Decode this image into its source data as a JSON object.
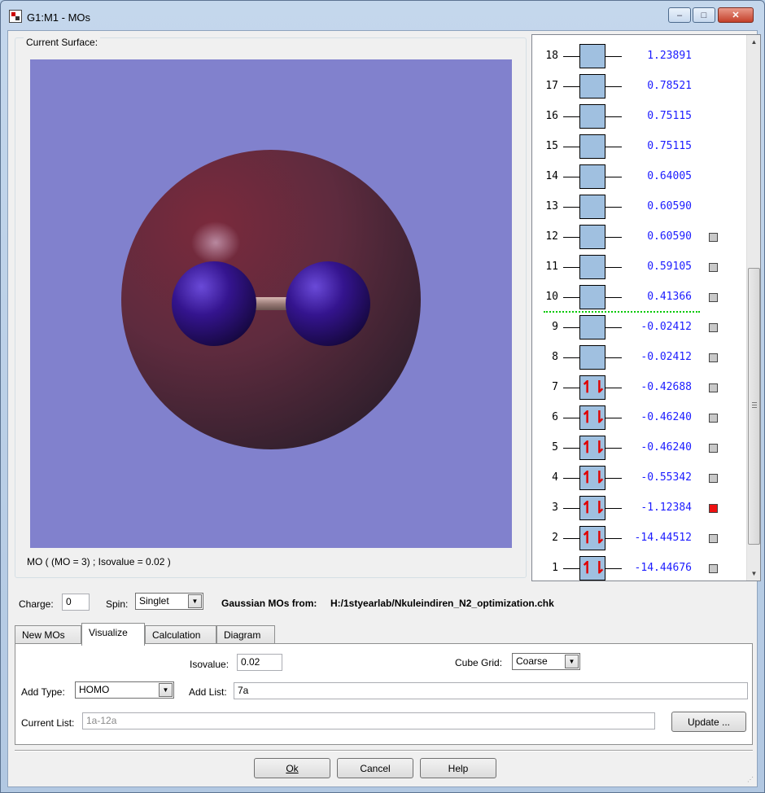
{
  "window": {
    "title": "G1:M1 - MOs",
    "minimize_glyph": "‒",
    "maximize_glyph": "□",
    "close_glyph": "✕"
  },
  "surface": {
    "legend": "Current Surface:",
    "caption": "MO ( (MO = 3) ; Isovalue = 0.02 )",
    "background_color": "#8181cd"
  },
  "mo_list": {
    "orbitals": [
      {
        "num": "18",
        "energy": "1.23891",
        "occupied": false,
        "checkbox": false
      },
      {
        "num": "17",
        "energy": "0.78521",
        "occupied": false,
        "checkbox": false
      },
      {
        "num": "16",
        "energy": "0.75115",
        "occupied": false,
        "checkbox": false
      },
      {
        "num": "15",
        "energy": "0.75115",
        "occupied": false,
        "checkbox": false
      },
      {
        "num": "14",
        "energy": "0.64005",
        "occupied": false,
        "checkbox": false
      },
      {
        "num": "13",
        "energy": "0.60590",
        "occupied": false,
        "checkbox": false
      },
      {
        "num": "12",
        "energy": "0.60590",
        "occupied": false,
        "checkbox": true
      },
      {
        "num": "11",
        "energy": "0.59105",
        "occupied": false,
        "checkbox": true
      },
      {
        "num": "10",
        "energy": "0.41366",
        "occupied": false,
        "checkbox": true
      },
      {
        "num": "9",
        "energy": "-0.02412",
        "occupied": false,
        "checkbox": true
      },
      {
        "num": "8",
        "energy": "-0.02412",
        "occupied": false,
        "checkbox": true
      },
      {
        "num": "7",
        "energy": "-0.42688",
        "occupied": true,
        "checkbox": true
      },
      {
        "num": "6",
        "energy": "-0.46240",
        "occupied": true,
        "checkbox": true
      },
      {
        "num": "5",
        "energy": "-0.46240",
        "occupied": true,
        "checkbox": true
      },
      {
        "num": "4",
        "energy": "-0.55342",
        "occupied": true,
        "checkbox": true
      },
      {
        "num": "3",
        "energy": "-1.12384",
        "occupied": true,
        "checkbox": true,
        "selected": true
      },
      {
        "num": "2",
        "energy": "-14.44512",
        "occupied": true,
        "checkbox": true
      },
      {
        "num": "1",
        "energy": "-14.44676",
        "occupied": true,
        "checkbox": true
      }
    ],
    "occupied_glyph": "↿⇂",
    "energy_color": "#1c1cff",
    "selected_color": "#ee1111",
    "fermi_line_color": "#00c800"
  },
  "controls": {
    "charge_label": "Charge:",
    "charge_value": "0",
    "spin_label": "Spin:",
    "spin_value": "Singlet",
    "source_label": "Gaussian MOs from:",
    "source_path": "H:/1styearlab/Nkuleindiren_N2_optimization.chk"
  },
  "tabs": [
    {
      "label": "New MOs"
    },
    {
      "label": "Visualize"
    },
    {
      "label": "Calculation"
    },
    {
      "label": "Diagram"
    }
  ],
  "visualize": {
    "isovalue_label": "Isovalue:",
    "isovalue_value": "0.02",
    "cube_grid_label": "Cube Grid:",
    "cube_grid_value": "Coarse",
    "add_type_label": "Add Type:",
    "add_type_value": "HOMO",
    "add_list_label": "Add List:",
    "add_list_value": "7a",
    "current_list_label": "Current List:",
    "current_list_value": "1a-12a",
    "update_button": "Update ..."
  },
  "buttons": {
    "ok": "Ok",
    "cancel": "Cancel",
    "help": "Help"
  }
}
